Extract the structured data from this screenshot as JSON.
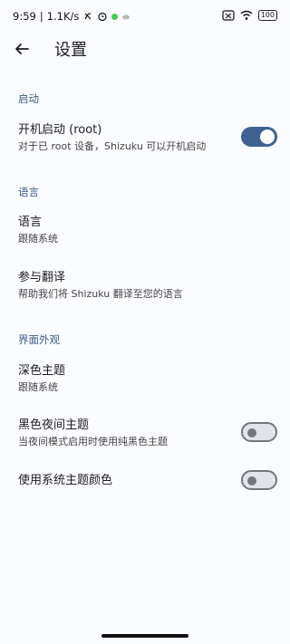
{
  "status": {
    "time": "9:59",
    "speed": "1.1K/s",
    "battery": "100"
  },
  "appbar": {
    "title": "设置"
  },
  "sections": {
    "startup": "启动",
    "language": "语言",
    "appearance": "界面外观"
  },
  "items": {
    "boot_title": "开机启动 (root)",
    "boot_sub": "对于已 root 设备，Shizuku 可以开机启动",
    "lang_title": "语言",
    "lang_sub": "跟随系统",
    "translate_title": "参与翻译",
    "translate_sub": "帮助我们将 Shizuku 翻译至您的语言",
    "dark_title": "深色主题",
    "dark_sub": "跟随系统",
    "black_title": "黑色夜间主题",
    "black_sub": "当夜间模式启用时使用纯黑色主题",
    "system_color_title": "使用系统主题颜色"
  },
  "switches": {
    "boot": "on",
    "black_theme": "off",
    "system_color": "off"
  },
  "colors": {
    "accent": "#3f6293",
    "section": "#3c5a86"
  }
}
